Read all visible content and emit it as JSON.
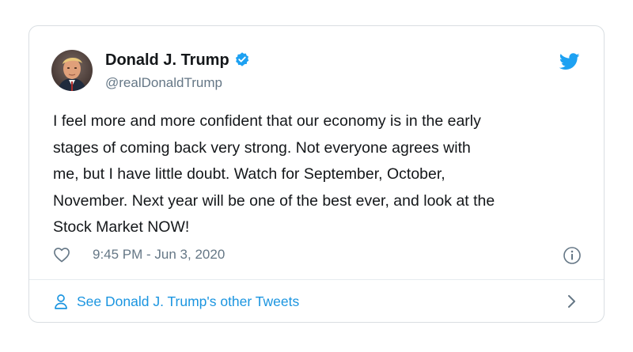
{
  "tweet": {
    "author_name": "Donald J. Trump",
    "handle": "@realDonaldTrump",
    "verified": true,
    "text": "I feel more and more confident that our economy is in the early\nstages of coming back very strong. Not everyone agrees with\nme, but I have little doubt. Watch for September, October,\nNovember. Next year will be one of the best ever, and look at the\nStock Market NOW!",
    "timestamp": "9:45 PM - Jun 3, 2020"
  },
  "footer": {
    "link_label": "See Donald J. Trump's other Tweets"
  },
  "icons": {
    "logo": "twitter-bird-icon",
    "verified": "verified-badge-icon",
    "like": "heart-icon",
    "info": "info-icon",
    "person": "person-icon",
    "chevron": "chevron-right-icon"
  },
  "colors": {
    "accent": "#1da1f2",
    "link": "#1b95e0",
    "text": "#14171a",
    "muted": "#657786",
    "border": "#d9dee2"
  }
}
